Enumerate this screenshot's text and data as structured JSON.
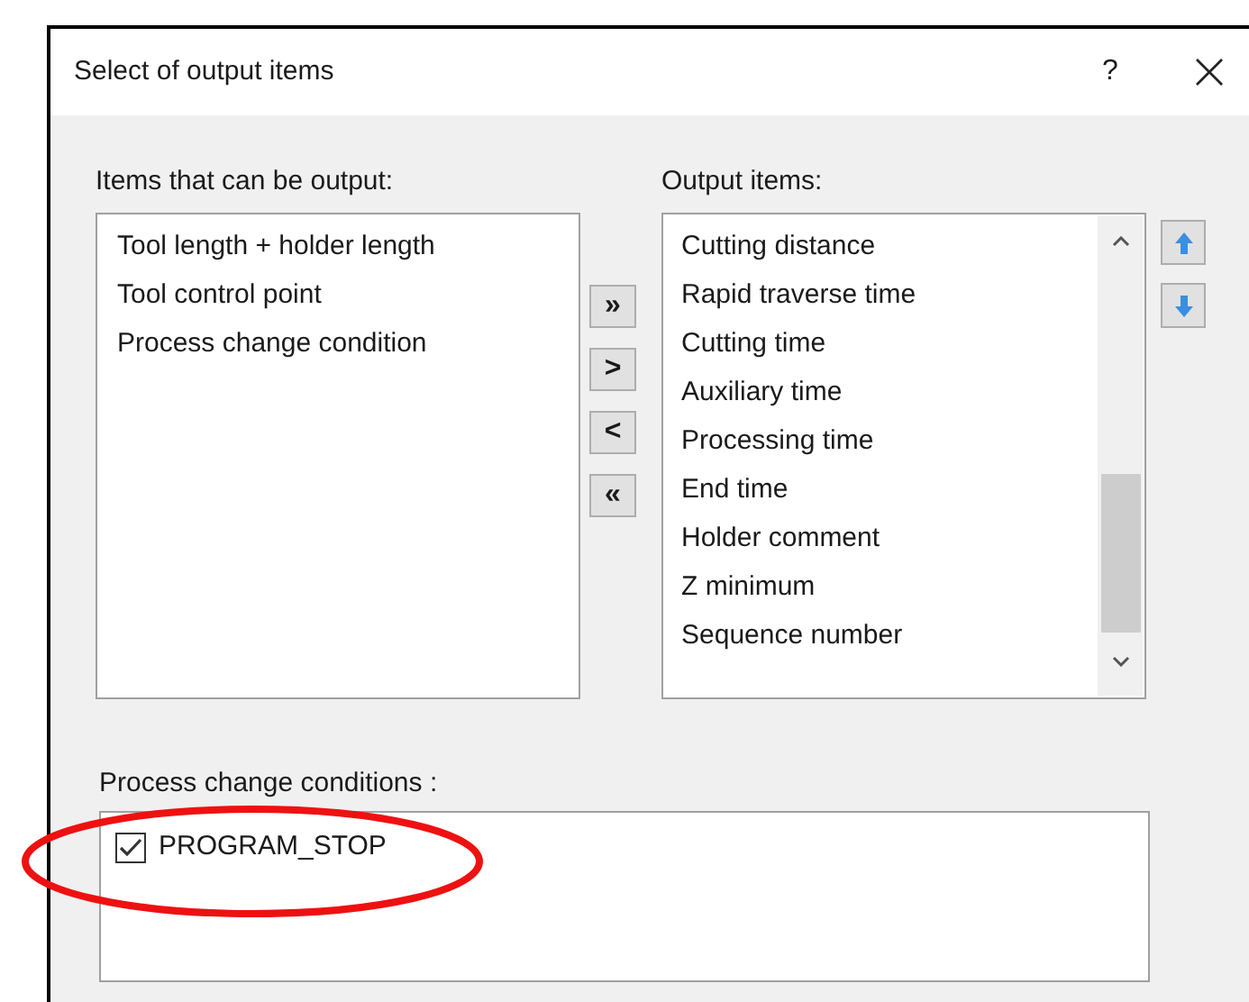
{
  "window": {
    "title": "Select of output items",
    "help": "?"
  },
  "available": {
    "label": "Items that can be output:",
    "items": [
      {
        "text": "Tool length + holder length"
      },
      {
        "text": "Tool control point"
      },
      {
        "text": "Process change condition"
      }
    ]
  },
  "move_buttons": [
    "»",
    ">",
    "<",
    "«"
  ],
  "output": {
    "label": "Output items:",
    "items": [
      {
        "text": "Cutting distance"
      },
      {
        "text": "Rapid traverse time"
      },
      {
        "text": "Cutting time"
      },
      {
        "text": "Auxiliary time"
      },
      {
        "text": "Processing time"
      },
      {
        "text": "End time"
      },
      {
        "text": "Holder comment"
      },
      {
        "text": "Z minimum"
      },
      {
        "text": "Sequence number"
      }
    ]
  },
  "conditions": {
    "label": "Process change conditions :",
    "items": [
      {
        "text": "PROGRAM_STOP",
        "checked": true
      }
    ]
  }
}
